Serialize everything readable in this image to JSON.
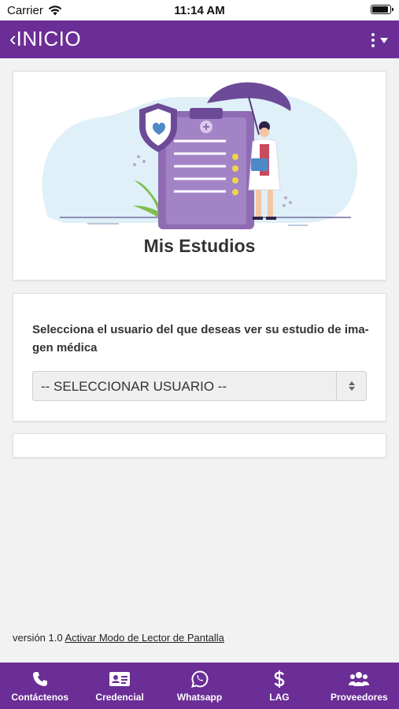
{
  "status_bar": {
    "carrier": "Carrier",
    "time": "11:14 AM"
  },
  "nav": {
    "back_chevron": "‹",
    "title": "INICIO",
    "menu_icon": "more-vertical-icon"
  },
  "hero": {
    "title": "Mis Estudios",
    "illustration": "doctor-clipboard-umbrella-illustration"
  },
  "selector": {
    "prompt": "Selecciona el usuario del que deseas ver su estudio de ima-gen médica",
    "prompt_line1": "Selecciona el usuario del que deseas ver su estudio de ima-",
    "prompt_line2": "gen médica",
    "selected_value": "-- SELECCIONAR USUARIO --"
  },
  "footer": {
    "version": "versión 1.0",
    "reader_link": "Activar Modo de Lector de Pantalla"
  },
  "tabs": [
    {
      "label": "Contáctenos",
      "icon": "phone-icon"
    },
    {
      "label": "Credencial",
      "icon": "id-card-icon"
    },
    {
      "label": "Whatsapp",
      "icon": "whatsapp-icon"
    },
    {
      "label": "LAG",
      "icon": "dollar-icon"
    },
    {
      "label": "Proveedores",
      "icon": "users-icon"
    }
  ],
  "colors": {
    "brand_purple": "#6b2d96",
    "background": "#f2f2f2",
    "card": "#ffffff"
  }
}
